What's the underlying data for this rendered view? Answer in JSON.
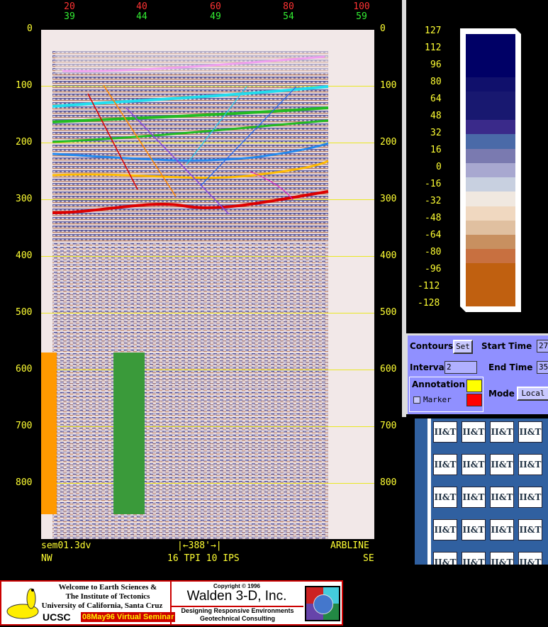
{
  "seismic": {
    "top_axis_red": [
      "20",
      "40",
      "60",
      "80",
      "100"
    ],
    "top_axis_green": [
      "39",
      "44",
      "49",
      "54",
      "59"
    ],
    "y_ticks": [
      "0",
      "100",
      "200",
      "300",
      "400",
      "500",
      "600",
      "700",
      "800"
    ],
    "footer_left_file": "sem01.3dv",
    "footer_left_dir": "NW",
    "footer_scale_label": "388'",
    "footer_center": "16 TPI 10 IPS",
    "footer_right_line": "ARBLINE",
    "footer_right_dir": "SE"
  },
  "colorbar": {
    "labels": [
      "127",
      "112",
      "96",
      "80",
      "64",
      "48",
      "32",
      "16",
      "0",
      "-16",
      "-32",
      "-48",
      "-64",
      "-80",
      "-96",
      "-112",
      "-128"
    ],
    "colors": [
      "#000066",
      "#000066",
      "#000066",
      "#10106c",
      "#181870",
      "#181870",
      "#3a2a8a",
      "#4a6aa8",
      "#7a7ab0",
      "#a8a8d0",
      "#c8d0e0",
      "#f0e8e0",
      "#f0d8c0",
      "#e0c0a0",
      "#c89060",
      "#c87040",
      "#c06010",
      "#c06010",
      "#c06010"
    ]
  },
  "controls": {
    "contours_label": "Contours:",
    "set_button": "Set",
    "start_time_label": "Start Time",
    "start_time_value": "27",
    "interval_label": "Interval",
    "interval_value": "2",
    "end_time_label": "End Time",
    "end_time_value": "35",
    "annotation_label": "Annotation",
    "marker_label": "Marker",
    "mode_label": "Mode",
    "mode_value": "Local",
    "annotation_color_1": "#ffff00",
    "annotation_color_2": "#ff0000"
  },
  "logos": {
    "tile_text": "II&T"
  },
  "banner": {
    "ucsc_line1": "Welcome to Earth Sciences &",
    "ucsc_line2": "The Institute of Tectonics",
    "ucsc_line3": "University of California, Santa Cruz",
    "ucsc_mark": "UCSC",
    "seminar": "08May96 Virtual Seminar",
    "copyright": "Copyright © 1996",
    "company": "Walden 3-D, Inc.",
    "tagline1": "Designing Responsive Environments",
    "tagline2": "Geotechnical Consulting"
  }
}
